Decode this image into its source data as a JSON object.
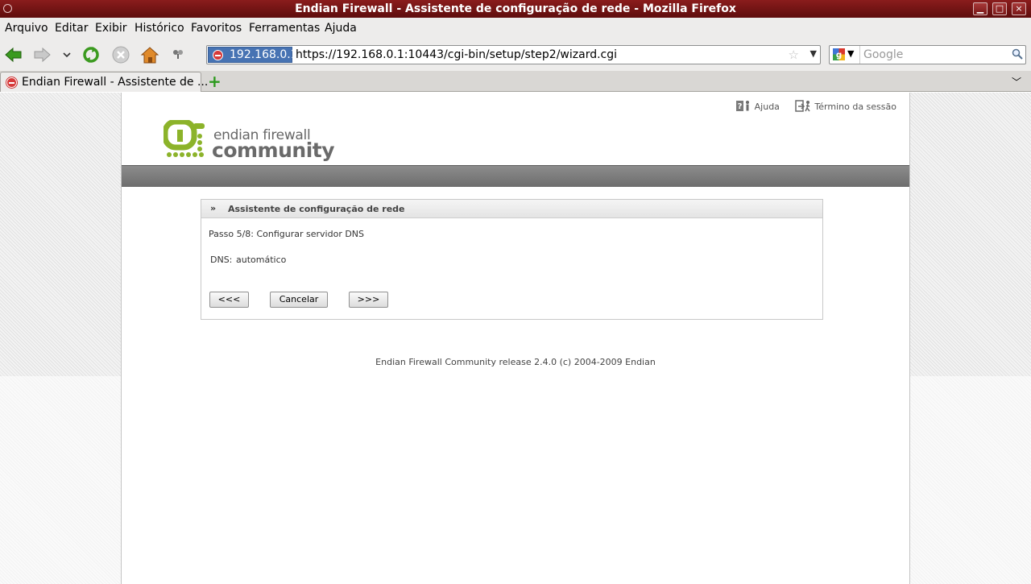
{
  "window": {
    "title": "Endian Firewall - Assistente de configuração de rede - Mozilla Firefox",
    "minimize": "▁",
    "maximize": "□",
    "close": "×"
  },
  "menubar": {
    "items": [
      "Arquivo",
      "Editar",
      "Exibir",
      "Histórico",
      "Favoritos",
      "Ferramentas",
      "Ajuda"
    ]
  },
  "toolbar": {
    "site_identity": "192.168.0.1",
    "url": "https://192.168.0.1:10443/cgi-bin/setup/step2/wizard.cgi",
    "search_placeholder": "Google"
  },
  "tabs": [
    {
      "label": "Endian Firewall - Assistente de ..."
    }
  ],
  "header": {
    "help_label": "Ajuda",
    "logout_label": "Término da sessão",
    "logo_line1": "endian firewall",
    "logo_line2": "community",
    "logo_color": "#8cb32a"
  },
  "panel": {
    "marker": "»",
    "title": "Assistente de configuração de rede",
    "step": "Passo 5/8: Configurar servidor DNS",
    "dns_label": "DNS:",
    "dns_value": "automático",
    "buttons": {
      "back": "<<<",
      "cancel": "Cancelar",
      "next": ">>>"
    }
  },
  "footer": {
    "text": "Endian Firewall Community release 2.4.0 (c) 2004-2009 Endian"
  }
}
